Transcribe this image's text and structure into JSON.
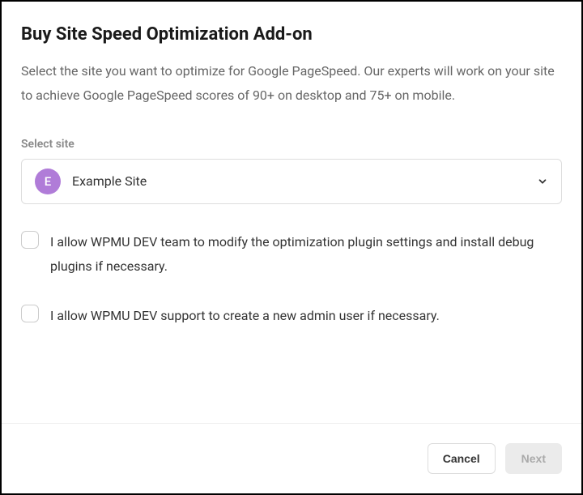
{
  "modal": {
    "title": "Buy Site Speed Optimization Add-on",
    "description": "Select the site you want to optimize for Google PageSpeed. Our experts will work on your site to achieve Google PageSpeed scores of 90+ on desktop and 75+ on mobile."
  },
  "siteField": {
    "label": "Select site",
    "avatarLetter": "E",
    "selectedName": "Example Site"
  },
  "checkboxes": {
    "allowModify": "I allow WPMU DEV team to modify the optimization plugin settings and install debug plugins if necessary.",
    "allowAdmin": "I allow WPMU DEV support to create a new admin user if necessary."
  },
  "footer": {
    "cancel": "Cancel",
    "next": "Next"
  }
}
